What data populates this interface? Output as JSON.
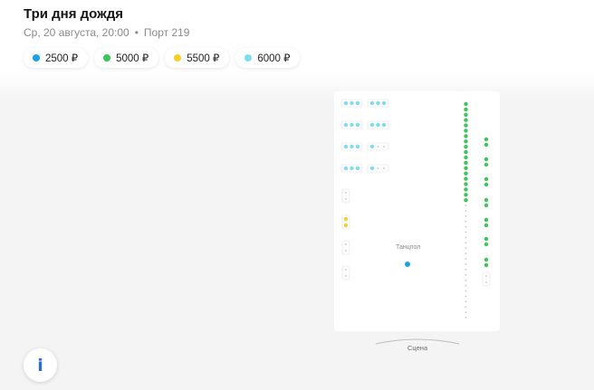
{
  "event": {
    "title": "Три дня дождя",
    "datetime": "Ср, 20 августа, 20:00",
    "venue": "Порт 219"
  },
  "prices": [
    {
      "label": "2500 ₽",
      "color": "#1aa3e0"
    },
    {
      "label": "5000 ₽",
      "color": "#3fc45a"
    },
    {
      "label": "5500 ₽",
      "color": "#f2d02a"
    },
    {
      "label": "6000 ₽",
      "color": "#7fdcf0"
    }
  ],
  "hall": {
    "dancefloor_label": "Танцпол",
    "stage_label": "Сцена"
  },
  "info_button": {
    "label": "i"
  }
}
